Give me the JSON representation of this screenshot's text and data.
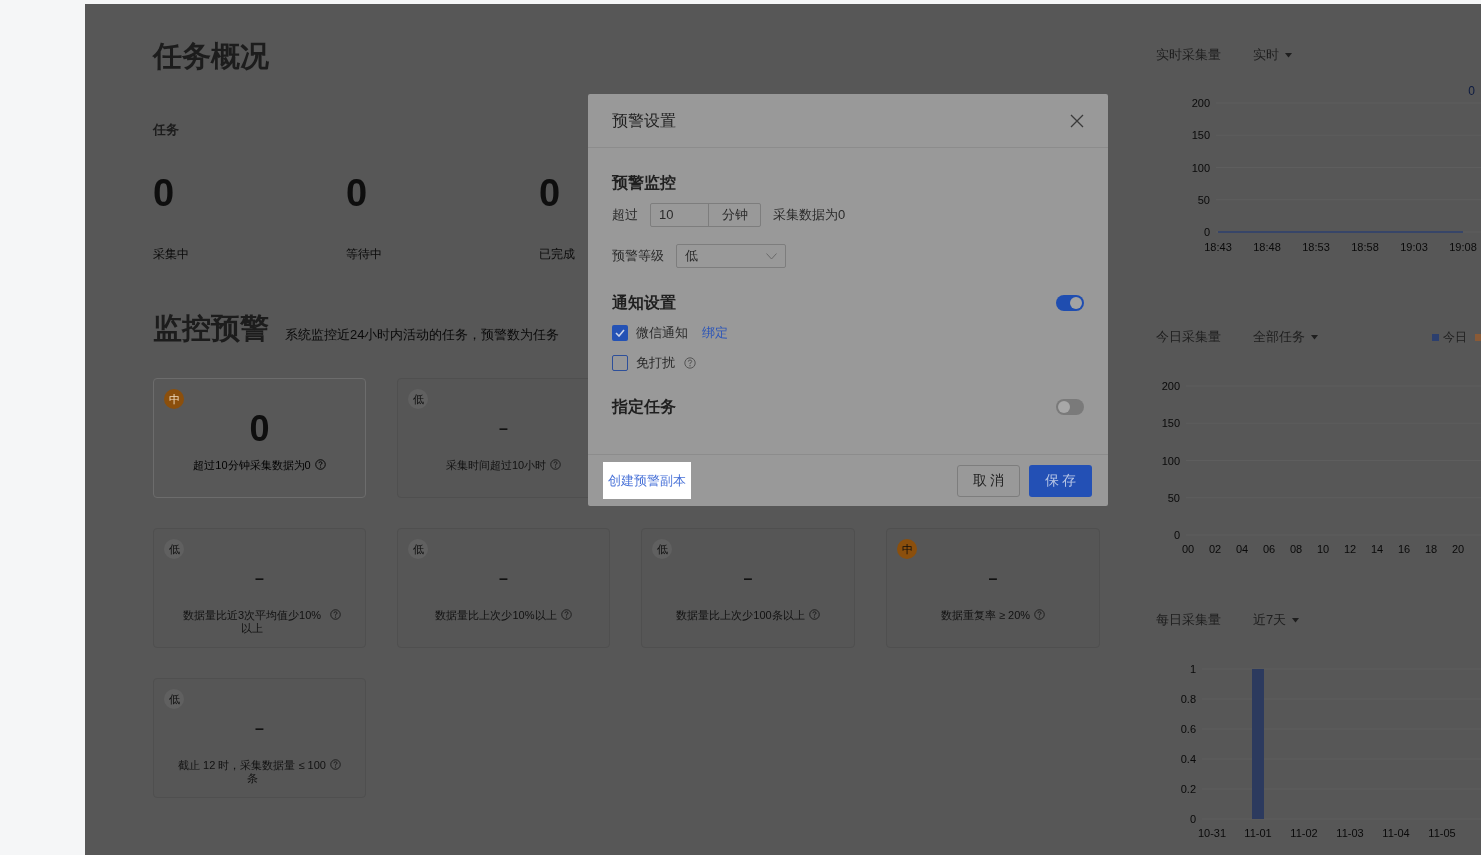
{
  "overview": {
    "title": "任务概况",
    "section_label": "任务",
    "stats": [
      {
        "value": "0",
        "label": "采集中"
      },
      {
        "value": "0",
        "label": "等待中"
      },
      {
        "value": "0",
        "label": "已完成"
      }
    ]
  },
  "monitor": {
    "title": "监控预警",
    "subtitle": "系统监控近24小时内活动的任务，预警数为任务",
    "cards": [
      {
        "badge": "中",
        "color": "#8b4f0c",
        "value": "0",
        "text": "超过10分钟采集数据为0",
        "active": true
      },
      {
        "badge": "低",
        "color": "#606060",
        "value": "–",
        "text": "采集时间超过10小时",
        "active": false
      },
      {
        "badge": "低",
        "color": "#606060",
        "value": "–",
        "text": "数据量比近3次平均值少10%以上",
        "active": false
      },
      {
        "badge": "低",
        "color": "#606060",
        "value": "–",
        "text": "数据量比上次少10%以上",
        "active": false
      },
      {
        "badge": "低",
        "color": "#606060",
        "value": "–",
        "text": "数据量比上次少100条以上",
        "active": false
      },
      {
        "badge": "中",
        "color": "#8b4f0c",
        "value": "–",
        "text": "数据重复率 ≥ 20%",
        "active": false
      },
      {
        "badge": "低",
        "color": "#606060",
        "value": "–",
        "text": "截止 12 时，采集数据量 ≤ 100 条",
        "active": false
      }
    ]
  },
  "charts": [
    {
      "title": "实时采集量",
      "filter": "实时",
      "total": "0",
      "chart_data": {
        "type": "line",
        "categories": [
          "18:43",
          "18:48",
          "18:53",
          "18:58",
          "19:03",
          "19:08"
        ],
        "series": [
          {
            "color": "#2c3f6e",
            "values": [
              0,
              0,
              0,
              0,
              0,
              0
            ]
          }
        ],
        "ylim": [
          0,
          200
        ],
        "yticks": [
          0,
          50,
          100,
          150,
          200
        ]
      }
    },
    {
      "title": "今日采集量",
      "filter": "全部任务",
      "chart_data": {
        "type": "bar",
        "categories": [
          "00",
          "02",
          "04",
          "06",
          "08",
          "10",
          "12",
          "14",
          "16",
          "18",
          "20"
        ],
        "series": [
          {
            "name": "今日",
            "color": "#2c3f6e",
            "values": [
              0,
              0,
              0,
              0,
              0,
              0,
              0,
              0,
              0,
              0,
              0
            ]
          }
        ],
        "ylim": [
          0,
          200
        ],
        "yticks": [
          0,
          50,
          100,
          150,
          200
        ]
      }
    },
    {
      "title": "每日采集量",
      "filter": "近7天",
      "chart_data": {
        "type": "bar",
        "categories": [
          "10-31",
          "11-01",
          "11-02",
          "11-03",
          "11-04",
          "11-05"
        ],
        "series": [
          {
            "color": "#2c3a5e",
            "values": [
              0,
              1,
              0,
              0,
              0,
              0
            ]
          }
        ],
        "ylim": [
          0,
          1
        ],
        "yticks": [
          0,
          {
            "value": 0.2,
            "label": "0.2"
          },
          {
            "value": 0.4,
            "label": "0.4"
          },
          {
            "value": 0.6,
            "label": "0.6"
          },
          {
            "value": 0.8,
            "label": "0.8"
          },
          1
        ]
      }
    }
  ],
  "dialog": {
    "title": "预警设置",
    "monitor_title": "预警监控",
    "exceed_label": "超过",
    "minutes_value": "10",
    "minutes_unit": "分钟",
    "condition_text": "采集数据为0",
    "level_label": "预警等级",
    "level_value": "低",
    "notify": {
      "title": "通知设置",
      "on": true,
      "options": [
        {
          "label": "微信通知",
          "checked": true,
          "link": "绑定",
          "help": false
        },
        {
          "label": "免打扰",
          "checked": false,
          "help": true
        }
      ]
    },
    "assign": {
      "title": "指定任务",
      "on": false
    },
    "copy_link": {
      "label": "创建预警副本",
      "highlighted": true
    },
    "buttons": [
      {
        "label": "取 消",
        "kind": "secondary"
      },
      {
        "label": "保 存",
        "kind": "primary"
      }
    ]
  }
}
